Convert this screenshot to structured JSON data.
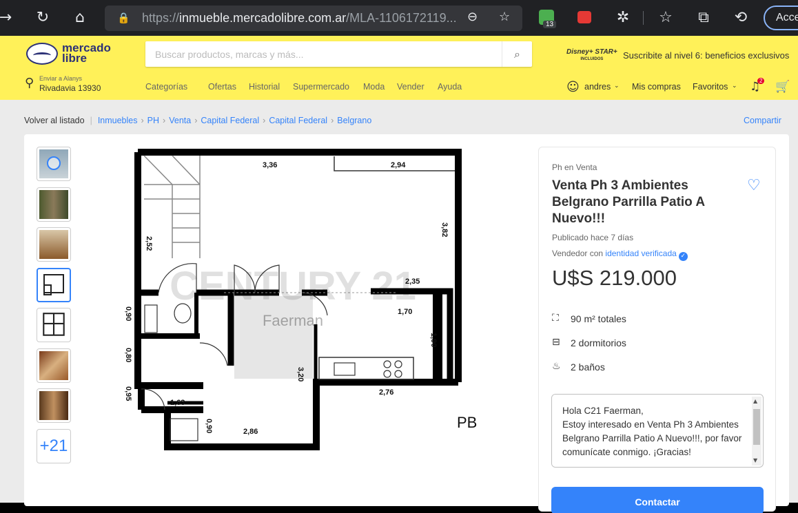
{
  "browser": {
    "url_prefix": "https://",
    "url_host": "inmueble.mercadolibre.com.ar",
    "url_path": "/MLA-1106172119...",
    "extension_badge_count": "13",
    "account_button": "Acce"
  },
  "header": {
    "logo_line1": "mercado",
    "logo_line2": "libre",
    "search_placeholder": "Buscar productos, marcas y más...",
    "promo_brand": "Disney+ STAR+",
    "promo_brand_small": "INCLUIDOS",
    "promo_text": "Suscribite al nivel 6: beneficios exclusivos",
    "ship_label": "Enviar a Alanys",
    "ship_address": "Rivadavia 13930",
    "nav": [
      "Categorías",
      "Ofertas",
      "Historial",
      "Supermercado",
      "Moda",
      "Vender",
      "Ayuda"
    ],
    "user": "andres",
    "my_purchases": "Mis compras",
    "favorites": "Favoritos",
    "notif_count": "2"
  },
  "breadcrumb": {
    "back": "Volver al listado",
    "items": [
      "Inmuebles",
      "PH",
      "Venta",
      "Capital Federal",
      "Capital Federal",
      "Belgrano"
    ],
    "share": "Compartir"
  },
  "gallery": {
    "more_count": "+21",
    "floorplan": {
      "watermark_main": "CENTURY 21",
      "watermark_sub": "Faerman",
      "floor_label": "PB",
      "dims": [
        "3,36",
        "2,94",
        "3,82",
        "2,52",
        "2,35",
        "1,70",
        "1,90",
        "0,90",
        "0,80",
        "3,20",
        "2,76",
        "0,95",
        "1,63",
        "0,90",
        "2,86"
      ]
    }
  },
  "listing": {
    "subtitle": "Ph en Venta",
    "title": "Venta Ph 3 Ambientes Belgrano Parrilla Patio A Nuevo!!!",
    "published": "Publicado hace 7 días",
    "seller_prefix": "Vendedor con",
    "seller_link": "identidad verificada",
    "price": "U$S 219.000",
    "features": [
      {
        "icon": "area-icon",
        "text": "90 m² totales"
      },
      {
        "icon": "bed-icon",
        "text": "2 dormitorios"
      },
      {
        "icon": "bath-icon",
        "text": "2 baños"
      }
    ],
    "message": "Hola C21 Faerman,\nEstoy interesado en Venta Ph 3 Ambientes Belgrano Parrilla Patio A Nuevo!!!, por favor comunícate conmigo. ¡Gracias!",
    "contact_button": "Contactar"
  },
  "colors": {
    "ml_yellow": "#fff159",
    "ml_blue": "#3483fa",
    "ml_navy": "#2d3277"
  }
}
